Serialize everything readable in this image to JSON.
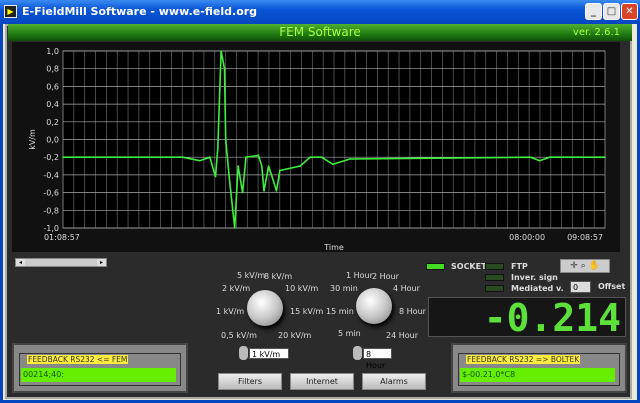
{
  "window": {
    "title": "E-FieldMill Software - www.e-field.org",
    "minimize": "_",
    "maximize": "□",
    "close": "✕"
  },
  "header": {
    "title": "FEM Software",
    "version": "ver. 2.6.1"
  },
  "chart_data": {
    "type": "line",
    "xlabel": "Time",
    "ylabel": "kV/m",
    "ylim": [
      -1.0,
      1.0
    ],
    "xlim": [
      "01:08:57",
      "09:08:57"
    ],
    "yticks": [
      "1,0",
      "0,8",
      "0,6",
      "0,4",
      "0,2",
      "0,0",
      "-0,2",
      "-0,4",
      "-0,6",
      "-0,8",
      "-1,0"
    ],
    "xticks": [
      "01:08:57",
      "08:00:00",
      "09:08:57"
    ],
    "grid": true,
    "color": "#3ef03e",
    "x": [
      "01:09",
      "02:55",
      "03:10",
      "03:19",
      "03:24",
      "03:26",
      "03:29",
      "03:32",
      "03:33",
      "03:36",
      "03:41",
      "03:44",
      "03:48",
      "03:51",
      "04:02",
      "04:05",
      "04:07",
      "04:11",
      "04:18",
      "04:21",
      "04:39",
      "04:48",
      "04:58",
      "05:08",
      "05:23",
      "08:03",
      "08:11",
      "08:20",
      "09:09"
    ],
    "y": [
      -0.2,
      -0.2,
      -0.24,
      -0.2,
      -0.42,
      -0.1,
      1.0,
      0.8,
      0.0,
      -0.4,
      -1.0,
      -0.3,
      -0.6,
      -0.2,
      -0.18,
      -0.3,
      -0.58,
      -0.3,
      -0.58,
      -0.35,
      -0.3,
      -0.2,
      -0.2,
      -0.28,
      -0.22,
      -0.2,
      -0.24,
      -0.2,
      -0.2
    ]
  },
  "range_knob": {
    "labels": [
      "0,5 kV/m",
      "1 kV/m",
      "2 kV/m",
      "5 kV/m",
      "8 kV/m",
      "10 kV/m",
      "15 kV/m",
      "20 kV/m"
    ],
    "value": "1 kV/m"
  },
  "time_knob": {
    "labels": [
      "5 min",
      "15 min",
      "30 min",
      "1 Hour",
      "2 Hour",
      "4 Hour",
      "8 Hour",
      "24 Hour"
    ],
    "value": "8 Hour"
  },
  "buttons": {
    "filters": "Filters",
    "internet": "Internet",
    "alarms": "Alarms"
  },
  "indicators": {
    "socket": "SOCKET",
    "ftp": "FTP",
    "inver": "Inver. sign",
    "mediated": "Mediated v.",
    "led_on": "#44dd22",
    "led_off": "#2a4a22"
  },
  "offset": {
    "value": "0",
    "label": "Offset"
  },
  "tools": "✛ ⌕ ✋",
  "display": {
    "value": "-0.214"
  },
  "feedback_in": {
    "title": "FEEDBACK RS232 <= FEM",
    "value": "00214;40:"
  },
  "feedback_out": {
    "title": "FEEDBACK RS232 => BOLTEK",
    "value": "$-00.21,0*C8"
  }
}
